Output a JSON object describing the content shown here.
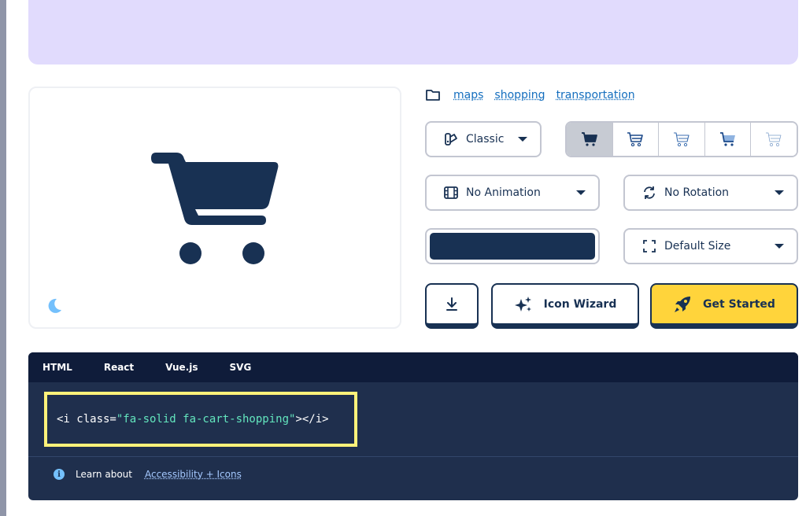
{
  "categories": {
    "icon": "folder-icon",
    "links": [
      "maps",
      "shopping",
      "transportation"
    ]
  },
  "controls": {
    "family": {
      "label": "Classic",
      "icon": "swatchbook-icon"
    },
    "styles": [
      {
        "name": "solid",
        "icon": "cart-shopping-icon",
        "active": true
      },
      {
        "name": "regular",
        "icon": "cart-shopping-icon",
        "active": false
      },
      {
        "name": "light",
        "icon": "cart-shopping-icon",
        "active": false
      },
      {
        "name": "duotone",
        "icon": "cart-shopping-icon",
        "active": false
      },
      {
        "name": "thin",
        "icon": "cart-shopping-icon",
        "active": false
      }
    ],
    "animation": {
      "label": "No Animation",
      "icon": "film-icon"
    },
    "rotation": {
      "label": "No Rotation",
      "icon": "rotate-icon"
    },
    "color": "#183153",
    "size": {
      "label": "Default Size",
      "icon": "expand-icon"
    }
  },
  "actions": {
    "download_icon": "download-icon",
    "wizard_label": "Icon Wizard",
    "wizard_icon": "sparkles-icon",
    "started_label": "Get Started",
    "started_icon": "rocket-icon"
  },
  "code": {
    "tabs": [
      "HTML",
      "React",
      "Vue.js",
      "SVG"
    ],
    "active_tab": "HTML",
    "snippet_open": "<i class=",
    "snippet_class": "\"fa-solid fa-cart-shopping\"",
    "snippet_close": "></i>"
  },
  "footer": {
    "learn_text": "Learn about",
    "learn_link": "Accessibility + Icons"
  },
  "colors": {
    "banner": "#e1dbfd",
    "navy": "#183153",
    "accent_yellow": "#ffd43b",
    "highlight": "#fff27a",
    "string_green": "#63e6be"
  }
}
